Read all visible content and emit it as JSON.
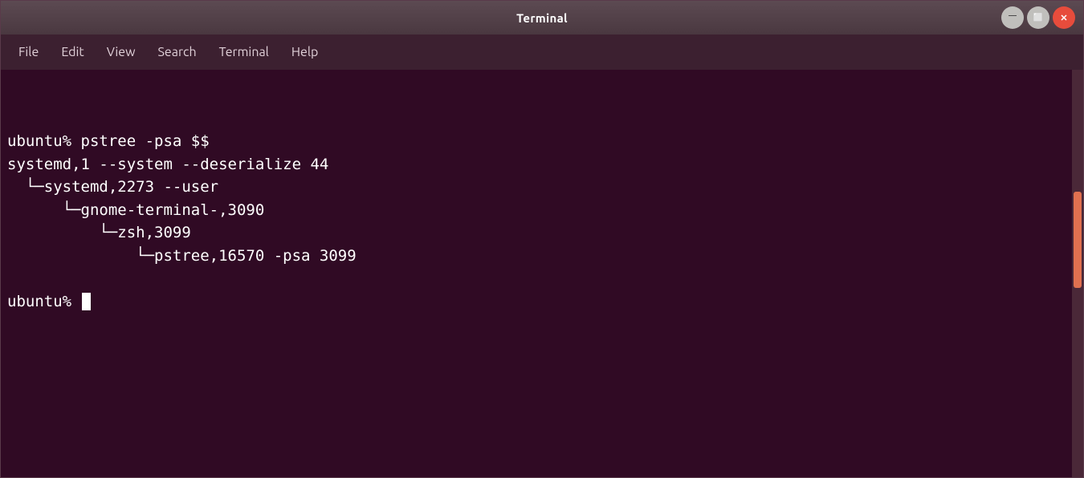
{
  "titlebar": {
    "title": "Terminal",
    "minimize_label": "minimize",
    "maximize_label": "maximize",
    "close_label": "close"
  },
  "menubar": {
    "items": [
      {
        "label": "File"
      },
      {
        "label": "Edit"
      },
      {
        "label": "View"
      },
      {
        "label": "Search"
      },
      {
        "label": "Terminal"
      },
      {
        "label": "Help"
      }
    ]
  },
  "terminal": {
    "lines": [
      "",
      "",
      "ubuntu% pstree -psa $$",
      "systemd,1 --system --deserialize 44",
      "  └─systemd,2273 --user",
      "      └─gnome-terminal-,3090",
      "          └─zsh,3099",
      "              └─pstree,16570 -psa 3099",
      "",
      "ubuntu% "
    ],
    "cursor_visible": true
  },
  "colors": {
    "titlebar_bg": "#4a3840",
    "menubar_bg": "#3c2030",
    "terminal_bg": "#300a24",
    "text": "#ffffff",
    "scrollbar_thumb": "#e07050"
  }
}
